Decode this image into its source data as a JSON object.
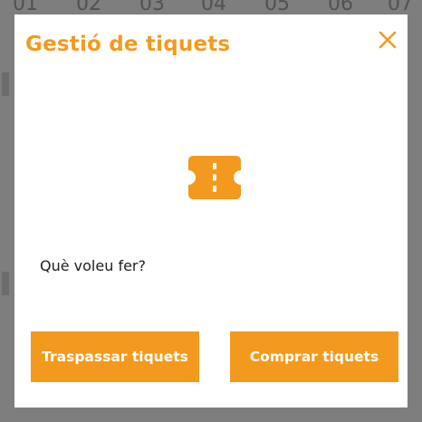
{
  "background": {
    "calendar_days": [
      "01",
      "02",
      "03",
      "04",
      "05",
      "06",
      "07"
    ]
  },
  "modal": {
    "title": "Gestió de tiquets",
    "close_icon": "close-icon",
    "illustration_icon": "ticket-icon",
    "question": "Què voleu fer?",
    "buttons": {
      "transfer": "Traspassar tiquets",
      "buy": "Comprar tiquets"
    }
  },
  "colors": {
    "accent": "#f39a1e",
    "overlay": "#7e7e7e",
    "surface": "#ffffff",
    "text": "#1f1f1f"
  }
}
